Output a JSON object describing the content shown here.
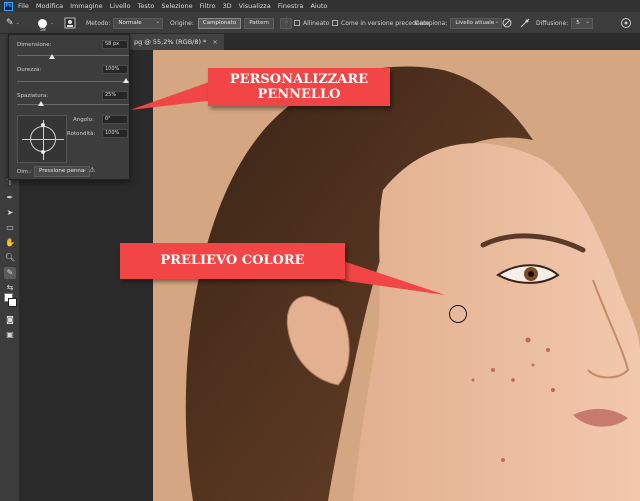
{
  "menubar": {
    "logo": "Ps",
    "items": [
      "File",
      "Modifica",
      "Immagine",
      "Livello",
      "Testo",
      "Selezione",
      "Filtro",
      "3D",
      "Visualizza",
      "Finestra",
      "Aiuto"
    ]
  },
  "options": {
    "brush_size": "58",
    "method_label": "Metodo:",
    "method_value": "Normale",
    "source_label": "Origine:",
    "source_sampled": "Campionato",
    "source_pattern": "Pattern",
    "aligned_label": "Allineato",
    "previous_version_label": "Come in versione precedente",
    "sample_label": "Campiona:",
    "sample_value": "Livello attuale",
    "diffusion_label": "Diffusione:",
    "diffusion_value": "5"
  },
  "document_tab": {
    "title": "pg @ 55,2% (RGB/8) *",
    "close": "×"
  },
  "brush_panel": {
    "size_label": "Dimensione:",
    "size_value": "58 px",
    "size_level": 0.3,
    "hardness_label": "Durezza:",
    "hardness_value": "100%",
    "hardness_level": 1.0,
    "spacing_label": "Spaziatura:",
    "spacing_value": "25%",
    "spacing_level": 0.2,
    "angle_label": "Angolo:",
    "angle_value": "0°",
    "roundness_label": "Rotondità:",
    "roundness_value": "100%",
    "dim_label": "Dim.:",
    "dim_value": "Pressione penna",
    "warning": "⚠"
  },
  "callouts": {
    "brush": "PERSONALIZZARE PENNELLO",
    "sample": "PRELIEVO COLORE"
  },
  "colors": {
    "callout": "#f24545",
    "skin_bg": "#d4a782",
    "ui_dark": "#3c3c3c"
  }
}
